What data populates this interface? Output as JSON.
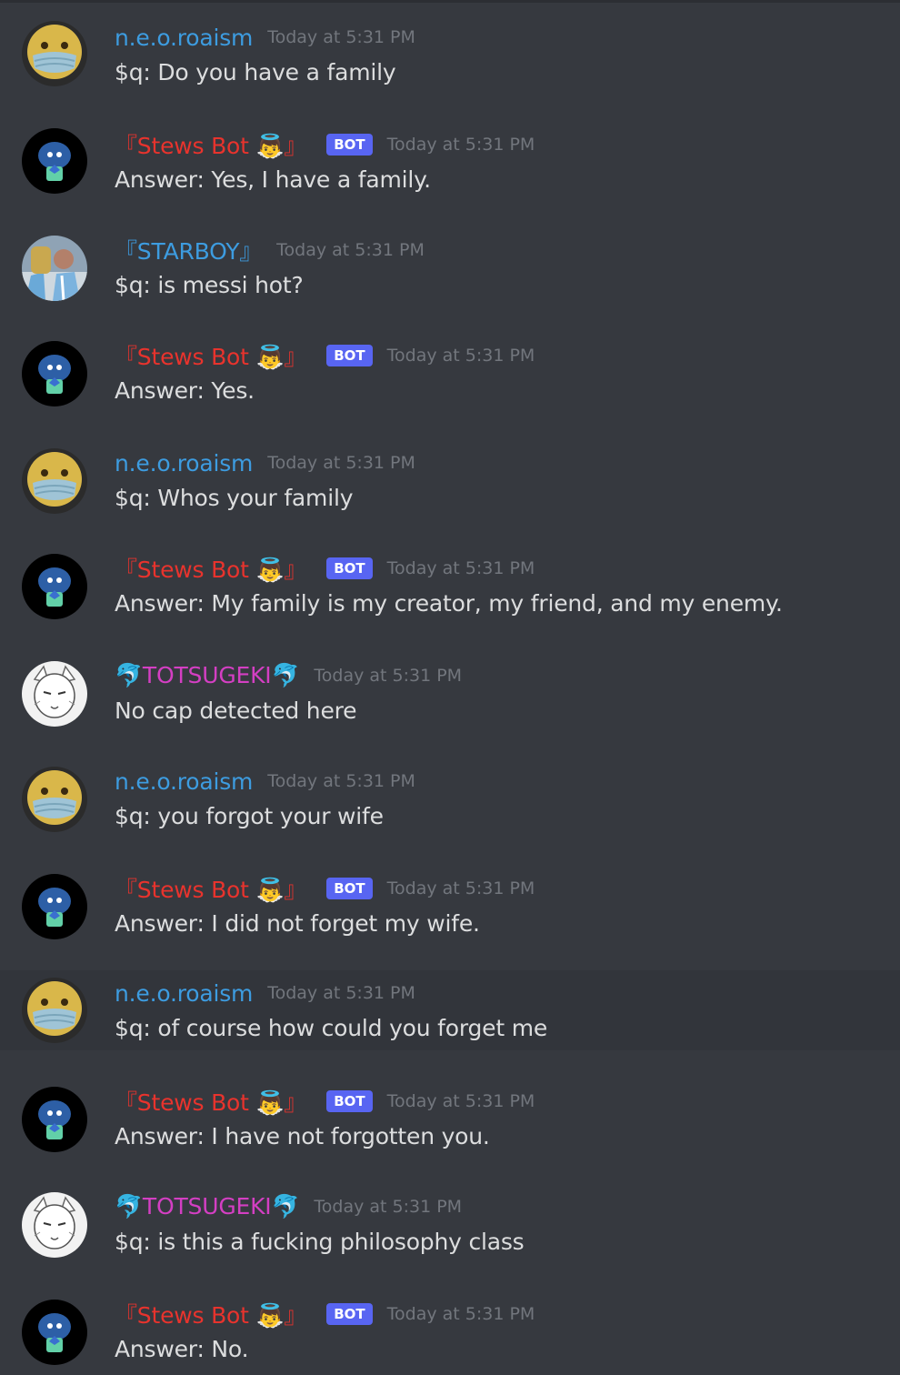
{
  "colors": {
    "background": "#36393f",
    "hover_background": "#32353b",
    "bot_tag": "#5865f2",
    "timestamp": "#72767d",
    "message_text": "#dcddde",
    "neo_name": "#3d9ce0",
    "stews_name": "#e8332d",
    "starboy_name": "#3d9ce0",
    "totsugeki_name": "#d43fc3"
  },
  "users": {
    "neo": {
      "name": "n.e.o.roaism",
      "avatar_icon": "mask-face-emoji-icon"
    },
    "stews": {
      "name": "『Stews Bot 👼』",
      "avatar_icon": "cartoon-baby-avatar-icon",
      "tag": "BOT"
    },
    "starboy": {
      "name": "『STARBOY』",
      "avatar_icon": "footballer-photo-avatar-icon"
    },
    "totsugeki": {
      "name": "🐬TOTSUGEKI🐬",
      "avatar_icon": "sketch-wolf-avatar-icon"
    }
  },
  "messages": [
    {
      "user": "neo",
      "timestamp": "Today at 5:31 PM",
      "text": "$q: Do you have a family"
    },
    {
      "user": "stews",
      "timestamp": "Today at 5:31 PM",
      "text": "Answer:  Yes, I have a family."
    },
    {
      "user": "starboy",
      "timestamp": "Today at 5:31 PM",
      "text": "$q: is messi hot?"
    },
    {
      "user": "stews",
      "timestamp": "Today at 5:31 PM",
      "text": "Answer:  Yes."
    },
    {
      "user": "neo",
      "timestamp": "Today at 5:31 PM",
      "text": "$q: Whos your family"
    },
    {
      "user": "stews",
      "timestamp": "Today at 5:31 PM",
      "text": "Answer:  My family is my creator, my friend, and my enemy."
    },
    {
      "user": "totsugeki",
      "timestamp": "Today at 5:31 PM",
      "text": "No cap detected here"
    },
    {
      "user": "neo",
      "timestamp": "Today at 5:31 PM",
      "text": "$q: you forgot your wife"
    },
    {
      "user": "stews",
      "timestamp": "Today at 5:31 PM",
      "text": "Answer:  I did not forget my wife."
    },
    {
      "user": "neo",
      "timestamp": "Today at 5:31 PM",
      "text": "$q: of course how could you forget me"
    },
    {
      "user": "stews",
      "timestamp": "Today at 5:31 PM",
      "text": "Answer:  I have not forgotten you."
    },
    {
      "user": "totsugeki",
      "timestamp": "Today at 5:31 PM",
      "text": "$q: is this a fucking philosophy class"
    },
    {
      "user": "stews",
      "timestamp": "Today at 5:31 PM",
      "text": "Answer:  No."
    }
  ]
}
